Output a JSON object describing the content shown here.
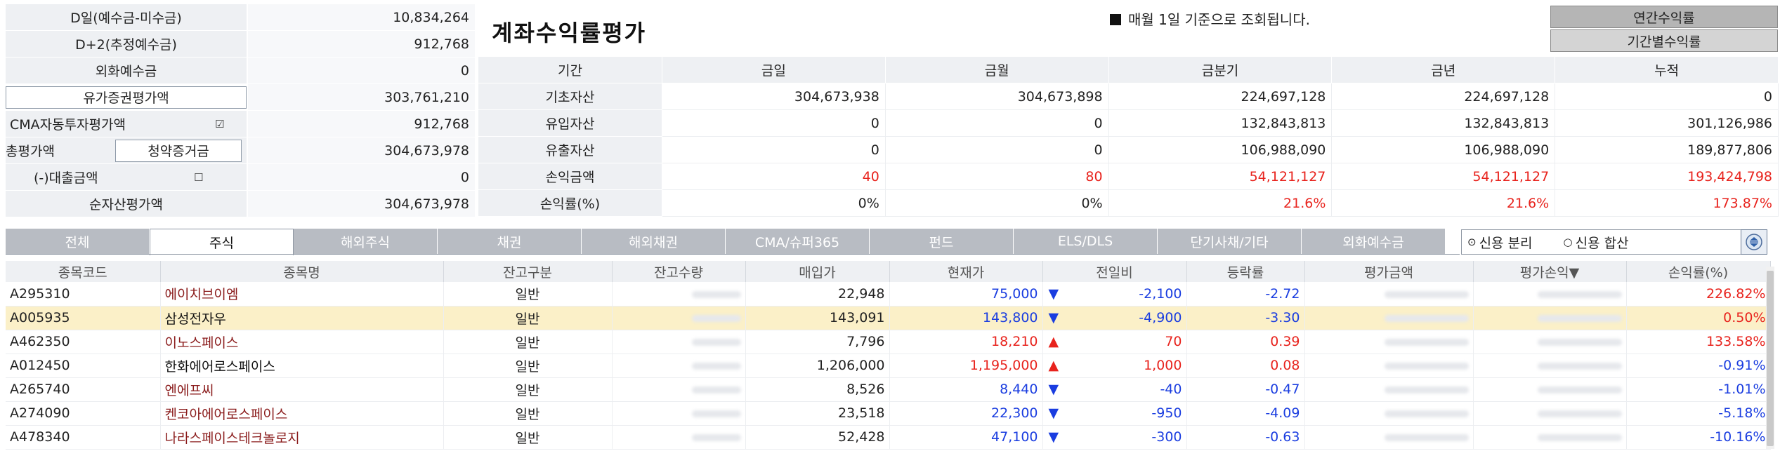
{
  "summary": {
    "rows": [
      {
        "label": "D일(예수금-미수금)",
        "value": "10,834,264"
      },
      {
        "label": "D+2(추정예수금)",
        "value": "912,768"
      },
      {
        "label": "외화예수금",
        "value": "0"
      },
      {
        "label": "유가증권평가액",
        "value": "303,761,210"
      },
      {
        "label": "CMA자동투자평가액",
        "value": "912,768"
      },
      {
        "label": "총평가액",
        "value": "304,673,978"
      },
      {
        "label": "(-)대출금액",
        "value": "0"
      },
      {
        "label": "순자산평가액",
        "value": "304,673,978"
      }
    ],
    "subscription_button": "청약증거금",
    "cma_checkbox": "☑",
    "loan_checkbox": "☐"
  },
  "evaluation": {
    "title": "계좌수익률평가",
    "notice": "매월 1일 기준으로 조회됩니다.",
    "annual_button": "연간수익률",
    "period_button": "기간별수익률",
    "headers": [
      "기간",
      "금일",
      "금월",
      "금분기",
      "금년",
      "누적"
    ],
    "rows": [
      {
        "label": "기초자산",
        "values": [
          "304,673,938",
          "304,673,898",
          "224,697,128",
          "224,697,128",
          "0"
        ],
        "color": ""
      },
      {
        "label": "유입자산",
        "values": [
          "0",
          "0",
          "132,843,813",
          "132,843,813",
          "301,126,986"
        ],
        "color": ""
      },
      {
        "label": "유출자산",
        "values": [
          "0",
          "0",
          "106,988,090",
          "106,988,090",
          "189,877,806"
        ],
        "color": ""
      },
      {
        "label": "손익금액",
        "values": [
          "40",
          "80",
          "54,121,127",
          "54,121,127",
          "193,424,798"
        ],
        "color": "red"
      },
      {
        "label": "손익률(%)",
        "values": [
          "0%",
          "0%",
          "21.6%",
          "21.6%",
          "173.87%"
        ],
        "color": "mixed"
      }
    ]
  },
  "tabs": [
    "전체",
    "주식",
    "해외주식",
    "채권",
    "해외채권",
    "CMA/슈퍼365",
    "펀드",
    "ELS/DLS",
    "단기사채/기타",
    "외화예수금"
  ],
  "active_tab": 1,
  "credit": {
    "option1": "신용 분리",
    "option2": "신용 합산",
    "selected": 0
  },
  "colors": {
    "red": "#e8231d",
    "blue": "#1a3de0",
    "selected_row": "#fbf0c8",
    "header_bg": "#eef0f3"
  },
  "grid": {
    "headers": [
      "종목코드",
      "종목명",
      "잔고구분",
      "잔고수량",
      "매입가",
      "현재가",
      "전일비",
      "등락률",
      "평가금액",
      "평가손익▼",
      "손익률(%)"
    ],
    "rows": [
      {
        "code": "A295310",
        "name": "에이치브이엠",
        "type": "일반",
        "buy": "22,948",
        "price": "75,000",
        "dir": "down",
        "change": "-2,100",
        "rate": "-2.72",
        "eval": "",
        "pl": "",
        "plrate": "226.82%",
        "price_color": "blue",
        "plrate_color": "red"
      },
      {
        "code": "A005935",
        "name": "삼성전자우",
        "type": "일반",
        "buy": "143,091",
        "price": "143,800",
        "dir": "down",
        "change": "-4,900",
        "rate": "-3.30",
        "eval": "",
        "pl": "",
        "plrate": "0.50%",
        "price_color": "blue",
        "plrate_color": "red"
      },
      {
        "code": "A462350",
        "name": "이노스페이스",
        "type": "일반",
        "buy": "7,796",
        "price": "18,210",
        "dir": "up",
        "change": "70",
        "rate": "0.39",
        "eval": "",
        "pl": "",
        "plrate": "133.58%",
        "price_color": "red",
        "plrate_color": "red"
      },
      {
        "code": "A012450",
        "name": "한화에어로스페이스",
        "type": "일반",
        "buy": "1,206,000",
        "price": "1,195,000",
        "dir": "up",
        "change": "1,000",
        "rate": "0.08",
        "eval": "",
        "pl": "",
        "plrate": "-0.91%",
        "price_color": "red",
        "plrate_color": "blue"
      },
      {
        "code": "A265740",
        "name": "엔에프씨",
        "type": "일반",
        "buy": "8,526",
        "price": "8,440",
        "dir": "down",
        "change": "-40",
        "rate": "-0.47",
        "eval": "",
        "pl": "",
        "plrate": "-1.01%",
        "price_color": "blue",
        "plrate_color": "blue"
      },
      {
        "code": "A274090",
        "name": "켄코아에어로스페이스",
        "type": "일반",
        "buy": "23,518",
        "price": "22,300",
        "dir": "down",
        "change": "-950",
        "rate": "-4.09",
        "eval": "",
        "pl": "",
        "plrate": "-5.18%",
        "price_color": "blue",
        "plrate_color": "blue"
      },
      {
        "code": "A478340",
        "name": "나라스페이스테크놀로지",
        "type": "일반",
        "buy": "52,428",
        "price": "47,100",
        "dir": "down",
        "change": "-300",
        "rate": "-0.63",
        "eval": "",
        "pl": "",
        "plrate": "-10.16%",
        "price_color": "blue",
        "plrate_color": "blue"
      }
    ]
  }
}
